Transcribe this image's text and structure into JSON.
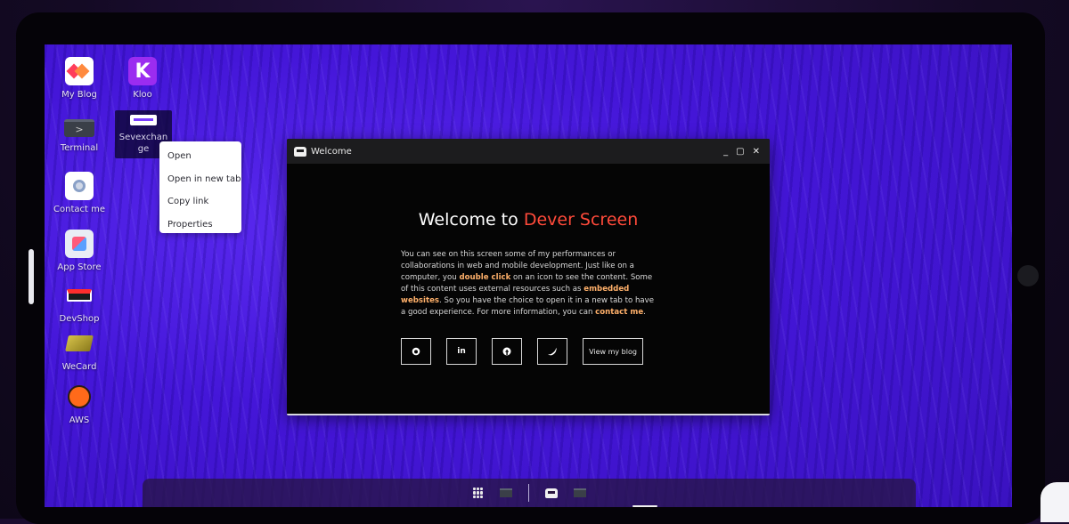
{
  "desktop": {
    "icons": [
      {
        "label": "My Blog",
        "icon": "blog-icon"
      },
      {
        "label": "Kloo",
        "icon": "kloo-icon",
        "glyph": "K"
      },
      {
        "label": "Terminal",
        "icon": "terminal-icon",
        "glyph": ">"
      },
      {
        "label": "Sevexchan\nge",
        "icon": "sevexchange-icon"
      },
      {
        "label": "Contact me",
        "icon": "contact-icon"
      },
      {
        "label": "App Store",
        "icon": "app-store-icon"
      },
      {
        "label": "DevShop",
        "icon": "devshop-icon"
      },
      {
        "label": "WeCard",
        "icon": "wecard-icon"
      },
      {
        "label": "AWS",
        "icon": "aws-icon"
      }
    ],
    "sevex_line1": "Sevexchan",
    "sevex_line2": "ge"
  },
  "context_menu": {
    "items": [
      "Open",
      "Open in new tab",
      "Copy link",
      "Properties"
    ]
  },
  "window": {
    "title": "Welcome",
    "controls": {
      "minimize": "_",
      "maximize": "▢",
      "close": "✕"
    },
    "heading_prefix": "Welcome to ",
    "heading_accent": "Dever Screen",
    "paragraph": {
      "p1": "You can see on this screen some of my performances or collaborations in web and mobile development. Just like on a computer, you ",
      "h1": "double click",
      "p2": " on an icon to see the content. Some of this content uses external resources such as ",
      "h2": "embedded websites",
      "p3": ". So you have the choice to open it in a new tab to have a good experience. For more information, you can ",
      "h3": "contact me",
      "p4": "."
    },
    "social": [
      {
        "icon": "github-icon",
        "glyph": "⌥"
      },
      {
        "icon": "linkedin-icon",
        "glyph": "in"
      },
      {
        "icon": "facebook-icon",
        "glyph": "f"
      },
      {
        "icon": "twitter-icon",
        "glyph": "🐦"
      }
    ],
    "blog_button": "View my blog"
  },
  "taskbar": {
    "apps": [
      "app-grid-icon",
      "terminal-icon",
      "welcome-icon",
      "terminal-icon"
    ]
  },
  "colors": {
    "accent": "#ff4a3a",
    "highlight": "#ffb06a",
    "wallpaper": "#4416d8"
  }
}
